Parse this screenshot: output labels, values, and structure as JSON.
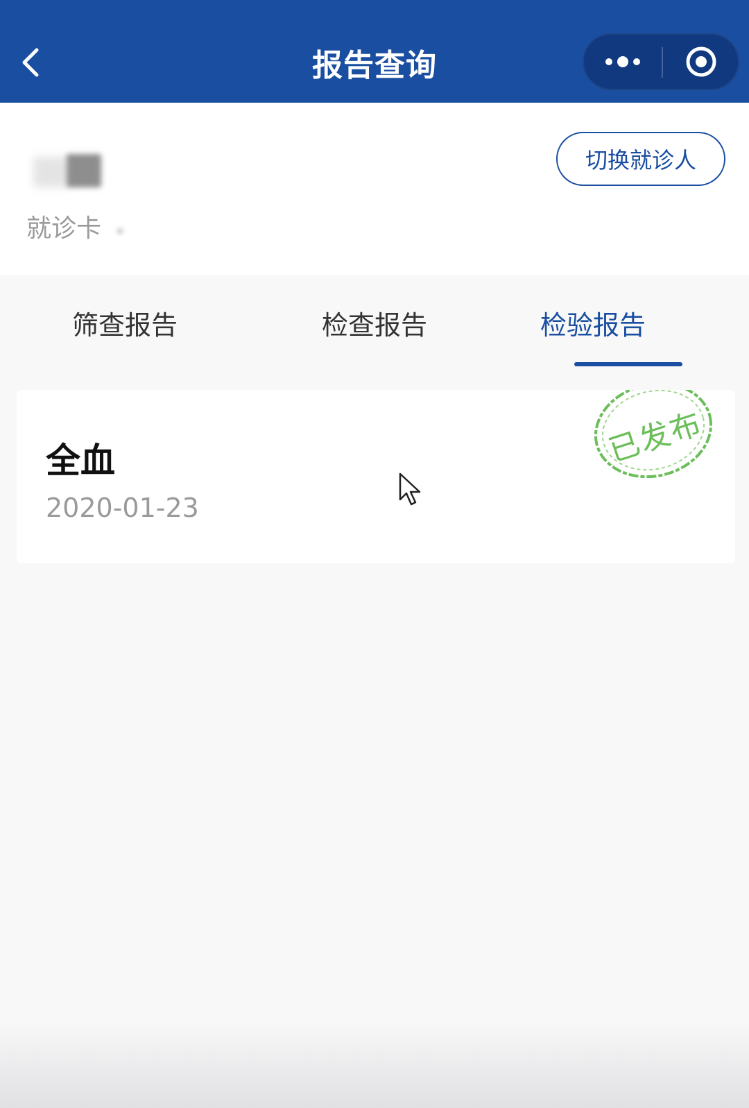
{
  "header": {
    "title": "报告查询",
    "back_icon": "chevron-left-icon",
    "more_icon": "more-dots-icon",
    "close_icon": "target-circle-icon"
  },
  "patient": {
    "card_label": "就诊卡",
    "switch_label": "切换就诊人"
  },
  "tabs": [
    {
      "label": "筛查报告",
      "active": false
    },
    {
      "label": "检查报告",
      "active": false
    },
    {
      "label": "检验报告",
      "active": true
    }
  ],
  "reports": [
    {
      "name": "全血",
      "date": "2020-01-23",
      "status": "已发布"
    }
  ],
  "colors": {
    "primary": "#1a4ea0",
    "stamp": "#6cbe5a",
    "background": "#f8f8f9"
  }
}
